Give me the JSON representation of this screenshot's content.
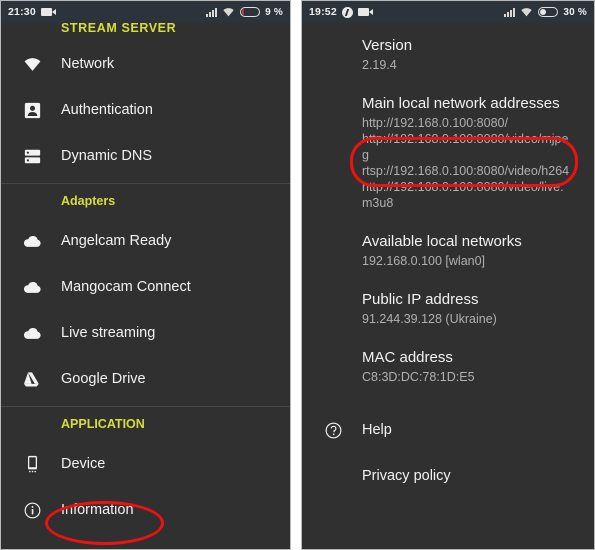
{
  "left_screen": {
    "statusbar": {
      "time": "21:30",
      "camera_icon": "camera-icon",
      "signal_icon": "signal-icon",
      "wifi_icon": "wifi-icon",
      "battery_icon": "battery-icon",
      "battery_percent": "9 %",
      "battery_level": 9,
      "battery_color": "#d03030"
    },
    "sections": [
      {
        "header": "STREAM SERVER",
        "header_color": "#d6de3a",
        "items": [
          {
            "label": "Network",
            "icon": "wifi-icon"
          },
          {
            "label": "Authentication",
            "icon": "user-badge-icon"
          },
          {
            "label": "Dynamic DNS",
            "icon": "server-icon"
          }
        ]
      },
      {
        "header": "Adapters",
        "header_color": "#d6de3a",
        "items": [
          {
            "label": "Angelcam Ready",
            "icon": "cloud-icon"
          },
          {
            "label": "Mangocam Connect",
            "icon": "cloud-icon"
          },
          {
            "label": "Live streaming",
            "icon": "cloud-icon"
          },
          {
            "label": "Google Drive",
            "icon": "google-drive-icon"
          }
        ]
      },
      {
        "header": "APPLICATION",
        "header_color": "#d6de3a",
        "items": [
          {
            "label": "Device",
            "icon": "phone-icon"
          },
          {
            "label": "Information",
            "icon": "info-circle-icon"
          }
        ]
      }
    ],
    "annotation": {
      "target": "Information",
      "color": "#ee1111",
      "shape": "oval"
    }
  },
  "right_screen": {
    "statusbar": {
      "time": "19:52",
      "charging_icon": "charging-bolt-icon",
      "camera_icon": "camera-icon",
      "signal_icon": "signal-icon",
      "wifi_icon": "wifi-icon",
      "battery_icon": "battery-icon",
      "battery_percent": "30 %",
      "battery_level": 30,
      "battery_color": "#e8e8e8"
    },
    "blocks": [
      {
        "title": "Version",
        "lines": [
          "2.19.4"
        ]
      },
      {
        "title": "Main local network addresses",
        "lines": [
          "http://192.168.0.100:8080/",
          "http://192.168.0.100:8080/video/mjpeg",
          "rtsp://192.168.0.100:8080/video/h264",
          "http://192.168.0.100:8080/video/live.m3u8"
        ]
      },
      {
        "title": "Available local networks",
        "lines": [
          "192.168.0.100 [wlan0]"
        ]
      },
      {
        "title": "Public IP address",
        "lines": [
          "91.244.39.128 (Ukraine)"
        ]
      },
      {
        "title": "MAC address",
        "lines": [
          "C8:3D:DC:78:1D:E5"
        ]
      }
    ],
    "links": [
      {
        "label": "Help",
        "icon": "help-circle-icon"
      },
      {
        "label": "Privacy policy",
        "icon": "none"
      }
    ],
    "annotation": {
      "target": "http://192.168.0.100:8080/video/mjpeg",
      "color": "#ee1111",
      "shape": "oval"
    }
  }
}
